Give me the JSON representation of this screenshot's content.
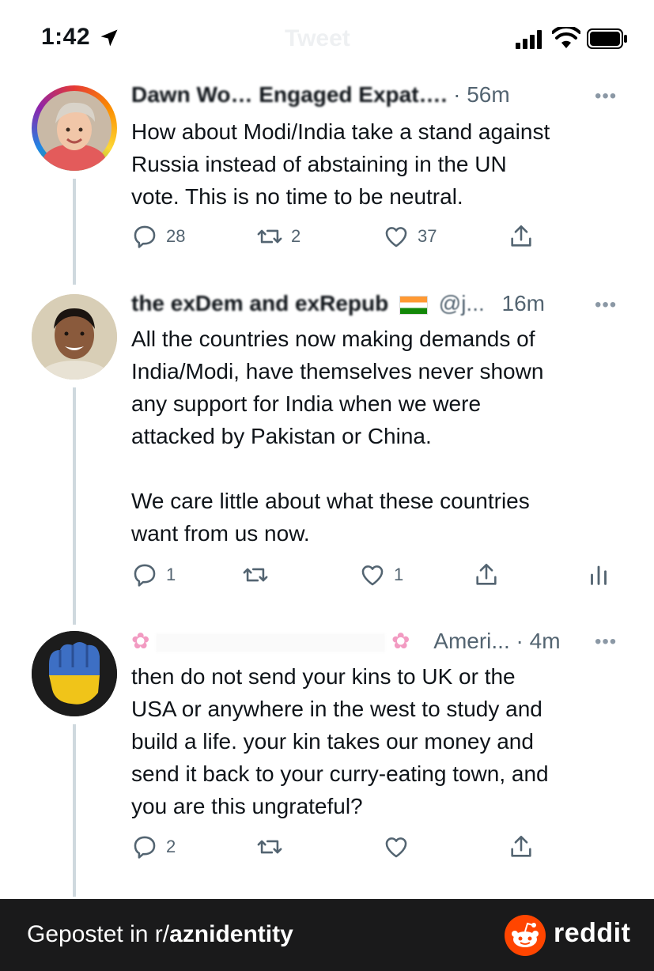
{
  "status_bar": {
    "time": "1:42",
    "ghost_title": "Tweet",
    "icons": [
      "location-arrow-icon",
      "signal-icon",
      "wifi-icon",
      "battery-icon"
    ]
  },
  "tweets": [
    {
      "name": "Dawn Wo… Engaged Expat….",
      "time": "· 56m",
      "more": "•••",
      "text": "How about Modi/India take a stand against\nRussia instead of abstaining in the UN\nvote. This is no time to be neutral.",
      "replies": "28",
      "retweets": "2",
      "likes": "37"
    },
    {
      "name": "the exDem and exRepub",
      "handle": "@j...",
      "time": "16m",
      "more": "•••",
      "text": "All the countries now making demands of\nIndia/Modi, have themselves never shown\nany support for India when we were\nattacked by Pakistan or China.\n\nWe care little about what these countries\nwant from us now.",
      "replies": "1",
      "retweets": "",
      "likes": "1"
    },
    {
      "name": "",
      "handle": "Ameri...",
      "time": "· 4m",
      "more": "•••",
      "text": "then do not send your kins to UK or the\nUSA or anywhere in the west to study and\nbuild a life. your kin takes our money and\nsend it back to your curry-eating town, and\nyou are this ungrateful?",
      "replies": "2",
      "retweets": "",
      "likes": ""
    }
  ],
  "footer": {
    "prefix": "Gepostet in r/",
    "subreddit": "aznidentity",
    "brand": "reddit"
  },
  "colors": {
    "text": "#0f1419",
    "muted": "#536471",
    "thread_line": "#cfd9de",
    "footer_bg": "#1a1a1b",
    "reddit_orange": "#ff4500"
  }
}
